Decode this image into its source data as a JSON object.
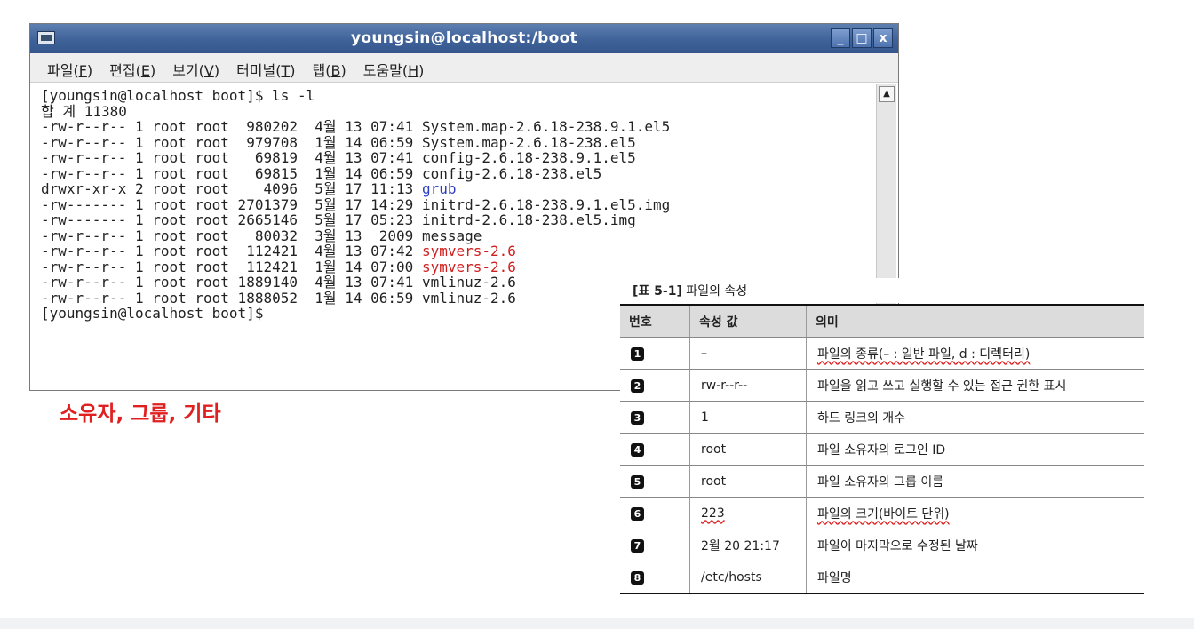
{
  "window": {
    "title": "youngsin@localhost:/boot",
    "buttons": {
      "minimize": "_",
      "maximize": "□",
      "close": "x"
    }
  },
  "menu": [
    {
      "label": "파일(",
      "key": "F",
      "end": ")"
    },
    {
      "label": "편집(",
      "key": "E",
      "end": ")"
    },
    {
      "label": "보기(",
      "key": "V",
      "end": ")"
    },
    {
      "label": "터미널(",
      "key": "T",
      "end": ")"
    },
    {
      "label": "탭(",
      "key": "B",
      "end": ")"
    },
    {
      "label": "도움말(",
      "key": "H",
      "end": ")"
    }
  ],
  "terminal": {
    "lines": [
      {
        "text": "[youngsin@localhost boot]$ ls -l"
      },
      {
        "text": "합 계 11380"
      },
      {
        "text": "-rw-r--r-- 1 root root  980202  4월 13 07:41 ",
        "name": "System.map-2.6.18-238.9.1.el5"
      },
      {
        "text": "-rw-r--r-- 1 root root  979708  1월 14 06:59 ",
        "name": "System.map-2.6.18-238.el5"
      },
      {
        "text": "-rw-r--r-- 1 root root   69819  4월 13 07:41 ",
        "name": "config-2.6.18-238.9.1.el5"
      },
      {
        "text": "-rw-r--r-- 1 root root   69815  1월 14 06:59 ",
        "name": "config-2.6.18-238.el5"
      },
      {
        "text": "drwxr-xr-x 2 root root    4096  5월 17 11:13 ",
        "name": "grub",
        "color": "blue"
      },
      {
        "text": "-rw------- 1 root root 2701379  5월 17 14:29 ",
        "name": "initrd-2.6.18-238.9.1.el5.img"
      },
      {
        "text": "-rw------- 1 root root 2665146  5월 17 05:23 ",
        "name": "initrd-2.6.18-238.el5.img"
      },
      {
        "text": "-rw-r--r-- 1 root root   80032  3월 13  2009 ",
        "name": "message"
      },
      {
        "text": "-rw-r--r-- 1 root root  112421  4월 13 07:42 ",
        "name": "symvers-2.6",
        "color": "red"
      },
      {
        "text": "-rw-r--r-- 1 root root  112421  1월 14 07:00 ",
        "name": "symvers-2.6",
        "color": "red"
      },
      {
        "text": "-rw-r--r-- 1 root root 1889140  4월 13 07:41 ",
        "name": "vmlinuz-2.6"
      },
      {
        "text": "-rw-r--r-- 1 root root 1888052  1월 14 06:59 ",
        "name": "vmlinuz-2.6"
      },
      {
        "text": "[youngsin@localhost boot]$"
      }
    ]
  },
  "caption": "소유자, 그룹, 기타",
  "table": {
    "title_bold": "[표 5-1]",
    "title_rest": " 파일의 속성",
    "headers": [
      "번호",
      "속성 값",
      "의미"
    ],
    "rows": [
      {
        "num": "1",
        "value": "–",
        "meaning": "파일의 종류(– : 일반 파일, d : 디렉터리)",
        "wavy_meaning": true
      },
      {
        "num": "2",
        "value": "rw-r--r--",
        "meaning": "파일을 읽고 쓰고 실행할 수 있는 접근 권한 표시"
      },
      {
        "num": "3",
        "value": "1",
        "meaning": "하드 링크의 개수"
      },
      {
        "num": "4",
        "value": "root",
        "meaning": "파일 소유자의 로그인 ID"
      },
      {
        "num": "5",
        "value": "root",
        "meaning": "파일 소유자의 그룹 이름"
      },
      {
        "num": "6",
        "value": "223",
        "meaning": "파일의 크기(바이트 단위)",
        "wavy_value": true,
        "wavy_meaning": true
      },
      {
        "num": "7",
        "value": "2월 20 21:17",
        "meaning": "파일이 마지막으로 수정된 날짜"
      },
      {
        "num": "8",
        "value": "/etc/hosts",
        "meaning": "파일명"
      }
    ]
  },
  "colors": {
    "titlebar": "#3f6299",
    "caption": "#e02020",
    "dir": "#2b3cc4",
    "exec_red": "#d02020"
  }
}
